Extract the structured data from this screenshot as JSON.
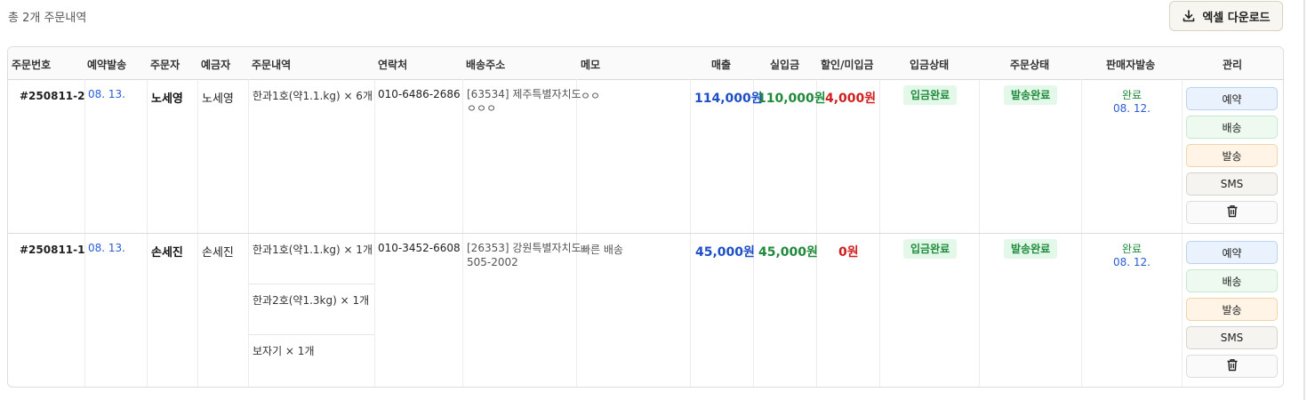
{
  "summary": {
    "total_label": "총 2개 주문내역"
  },
  "toolbar": {
    "excel_label": "엑셀 다운로드",
    "excel_icon": "download-icon"
  },
  "table": {
    "headers": [
      "주문번호",
      "예약발송",
      "주문자",
      "예금자",
      "주문내역",
      "연락처",
      "배송주소",
      "메모",
      "매출",
      "실입금",
      "할인/미입금",
      "입금상태",
      "주문상태",
      "판매자발송",
      "관리"
    ],
    "rows": [
      {
        "order_no": "#250811-2",
        "reservation_date": "08. 13.",
        "orderer": "노세영",
        "depositor": "노세영",
        "items": [
          "한과1호(약1.1.kg) × 6개"
        ],
        "phone": "010-6486-2686",
        "address_line1": "[63534] 제주특별자치도",
        "address_line2": "ㅇㅇㅇ",
        "memo": "ㅇㅇ",
        "sales": "114,000원",
        "paid": "110,000원",
        "discount": "4,000원",
        "payment_status": "입금완료",
        "order_status": "발송완료",
        "seller_status": "완료",
        "seller_date": "08. 12."
      },
      {
        "order_no": "#250811-1",
        "reservation_date": "08. 13.",
        "orderer": "손세진",
        "depositor": "손세진",
        "items": [
          "한과1호(약1.1.kg) × 1개",
          "한과2호(약1.3kg) × 1개",
          "보자기 × 1개"
        ],
        "phone": "010-3452-6608",
        "address_line1": "[26353] 강원특별자치도",
        "address_line2": "505-2002",
        "memo": "빠른 배송",
        "sales": "45,000원",
        "paid": "45,000원",
        "discount": "0원",
        "payment_status": "입금완료",
        "order_status": "발송완료",
        "seller_status": "완료",
        "seller_date": "08. 12."
      }
    ]
  },
  "actions": {
    "reserve": "예약",
    "ship": "배송",
    "dispatch": "발송",
    "sms": "SMS",
    "delete_icon": "trash-icon"
  },
  "colors": {
    "sales": "#1e4fc6",
    "paid": "#1f8a3b",
    "discount": "#cf1f1f",
    "badge_bg": "#e3f8e8",
    "badge_text": "#1e8a3c"
  }
}
